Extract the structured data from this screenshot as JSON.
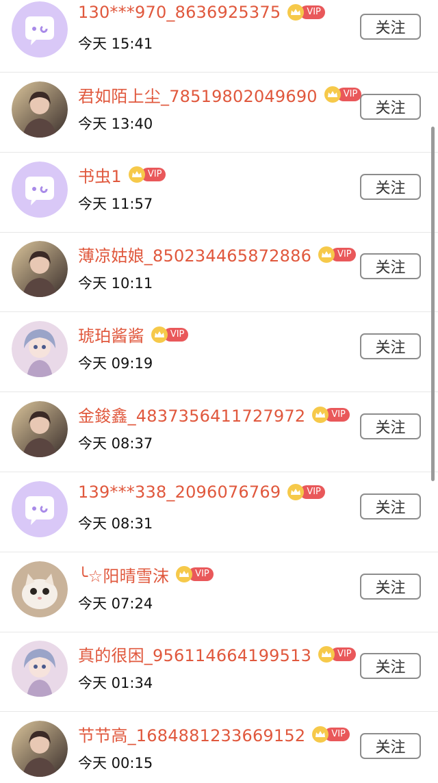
{
  "follow_label": "关注",
  "vip_label": "VIP",
  "users": [
    {
      "name": "130***970_8636925375",
      "time": "今天 15:41",
      "avatar": "default-chat-icon"
    },
    {
      "name": "君如陌上尘_78519802049690",
      "time": "今天 13:40",
      "avatar": "photo"
    },
    {
      "name": "书虫1",
      "time": "今天 11:57",
      "avatar": "default-chat-icon"
    },
    {
      "name": "薄凉姑娘_850234465872886",
      "time": "今天 10:11",
      "avatar": "photo"
    },
    {
      "name": "琥珀酱酱",
      "time": "今天 09:19",
      "avatar": "illustration"
    },
    {
      "name": "金鋑鑫_4837356411727972",
      "time": "今天 08:37",
      "avatar": "photo"
    },
    {
      "name": "139***338_2096076769",
      "time": "今天 08:31",
      "avatar": "default-chat-icon"
    },
    {
      "name": "╰☆阳晴雪沫",
      "time": "今天 07:24",
      "avatar": "cat-photo"
    },
    {
      "name": "真的很困_956114664199513",
      "time": "今天 01:34",
      "avatar": "illustration"
    },
    {
      "name": "节节高_1684881233669152",
      "time": "今天 00:15",
      "avatar": "photo"
    }
  ],
  "colors": {
    "username": "#e0583d",
    "vip_badge": "#e9585a",
    "crown": "#f6c94a",
    "default_avatar_bg": "#d9c8f7"
  }
}
